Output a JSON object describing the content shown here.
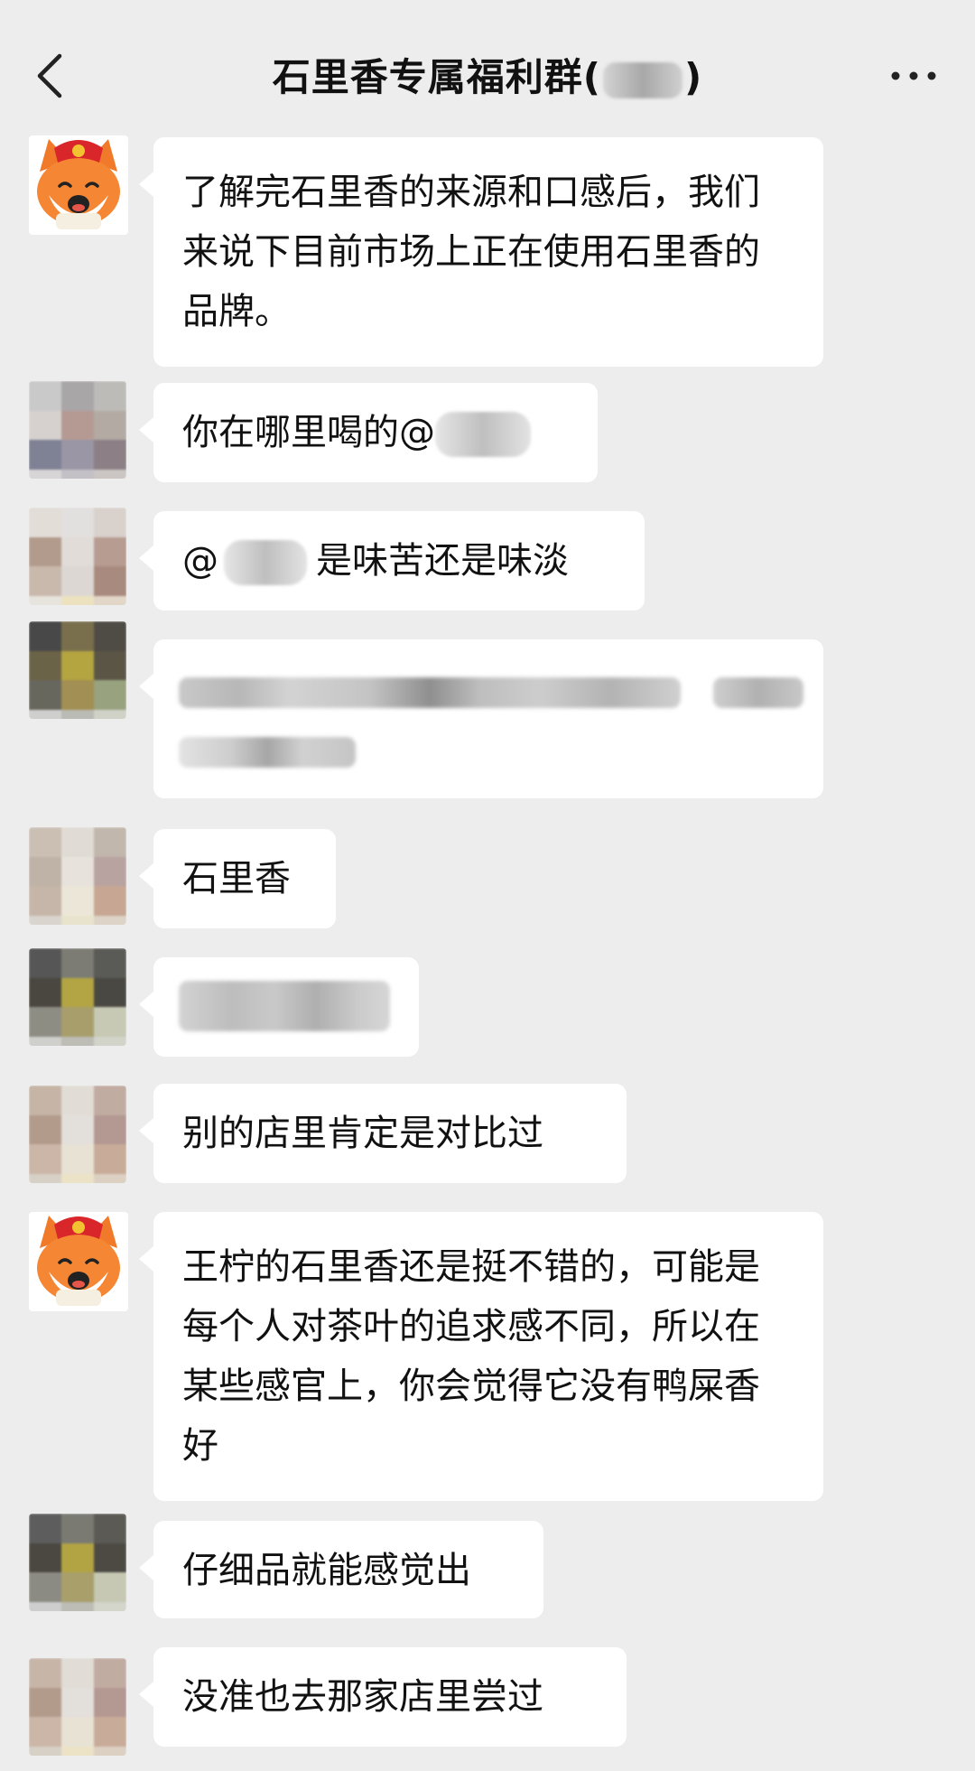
{
  "header": {
    "title_prefix": "石里香专属福利群(",
    "title_suffix": ")"
  },
  "icons": {
    "back": "chevron-left-icon",
    "more": "more-dots-icon"
  },
  "messages": [
    {
      "text": "了解完石里香的来源和口感后，我们来说下目前市场上正在使用石里香的品牌。"
    },
    {
      "text_before": "你在哪里喝的@"
    },
    {
      "text_before": "@",
      "text_after": "是味苦还是味淡"
    },
    {
      "text": ""
    },
    {
      "text": "石里香"
    },
    {
      "text": ""
    },
    {
      "text": "别的店里肯定是对比过"
    },
    {
      "text": "王柠的石里香还是挺不错的，可能是每个人对茶叶的追求感不同，所以在某些感官上，你会觉得它没有鸭屎香好"
    },
    {
      "text": "仔细品就能感觉出"
    },
    {
      "text": "没准也去那家店里尝过"
    }
  ]
}
